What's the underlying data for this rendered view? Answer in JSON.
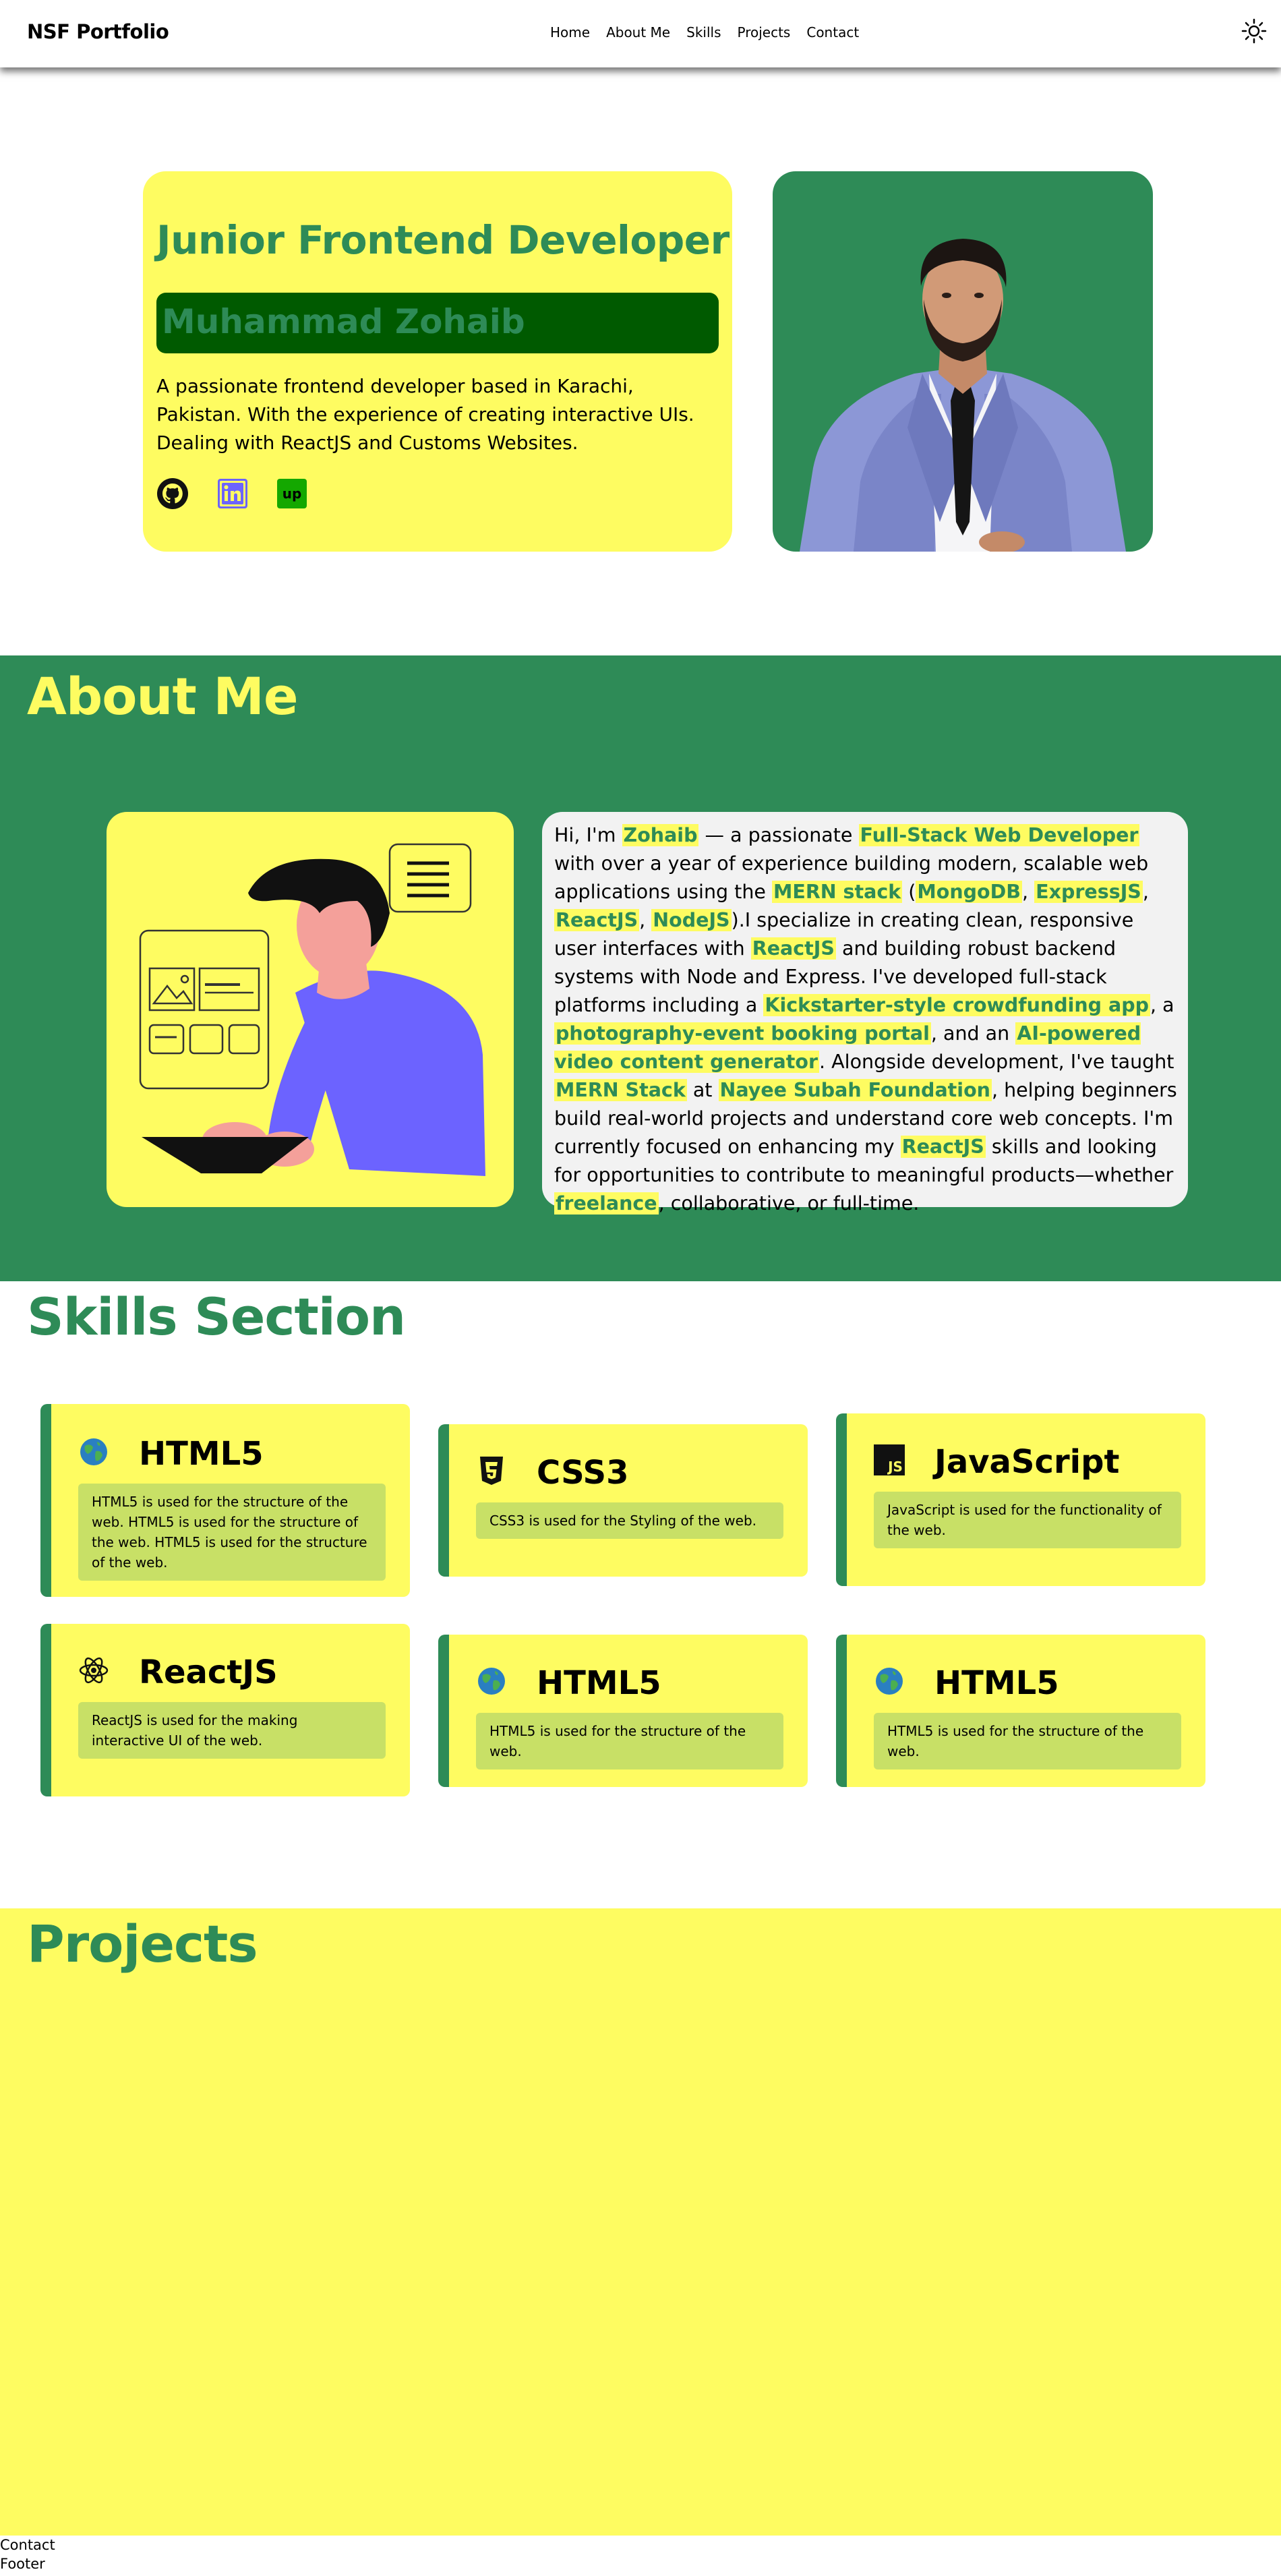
{
  "nav": {
    "brand": "NSF Portfolio",
    "links": [
      "Home",
      "About Me",
      "Skills",
      "Projects",
      "Contact"
    ]
  },
  "hero": {
    "title": "Junior Frontend Developer",
    "name": "Muhammad Zohaib",
    "description": "A passionate frontend developer based in Karachi, Pakistan. With the experience of creating interactive UIs. Dealing with ReactJS and Customs Websites.",
    "upwork_label": "up"
  },
  "about": {
    "title": "About Me",
    "p": [
      "Hi, I'm ",
      "Zohaib",
      " — a passionate ",
      "Full-Stack Web Developer",
      " with over a year of experience building modern, scalable web applications using the ",
      "MERN stack",
      " (",
      "MongoDB",
      ", ",
      "ExpressJS",
      ", ",
      "ReactJS",
      ", ",
      "NodeJS",
      ").I specialize in creating clean, responsive user interfaces with ",
      "ReactJS",
      " and building robust backend systems with Node and Express. I've developed full-stack platforms including a ",
      "Kickstarter-style crowdfunding app",
      ", a ",
      "photography-event booking portal",
      ", and an ",
      "AI-powered video content generator",
      ". Alongside development, I've taught ",
      "MERN Stack",
      " at ",
      "Nayee Subah Foundation",
      ", helping beginners build real-world projects and understand core web concepts. I'm currently focused on enhancing my ",
      "ReactJS",
      " skills and looking for opportunities to contribute to meaningful products—whether ",
      "freelance",
      ", collaborative, or full-time."
    ]
  },
  "skills": {
    "title": "Skills Section",
    "items": [
      {
        "name": "HTML5",
        "desc": "HTML5 is used for the structure of the web. HTML5 is used for the structure of the web. HTML5 is used for the structure of the web.",
        "icon": "globe-icon"
      },
      {
        "name": "CSS3",
        "desc": "CSS3 is used for the Styling of the web.",
        "icon": "css3-icon"
      },
      {
        "name": "JavaScript",
        "desc": "JavaScript is used for the functionality of the web.",
        "icon": "javascript-icon"
      },
      {
        "name": "ReactJS",
        "desc": "ReactJS is used for the making interactive UI of the web.",
        "icon": "react-icon"
      },
      {
        "name": "HTML5",
        "desc": "HTML5 is used for the structure of the web.",
        "icon": "globe-icon"
      },
      {
        "name": "HTML5",
        "desc": "HTML5 is used for the structure of the web.",
        "icon": "globe-icon"
      }
    ]
  },
  "projects": {
    "title": "Projects"
  },
  "footer": {
    "contact": "Contact",
    "footer": "Footer"
  },
  "colors": {
    "green": "#2e8b57",
    "yellow": "#fefc61",
    "dark_green": "#005a00",
    "skill_box": "#c8e066"
  }
}
